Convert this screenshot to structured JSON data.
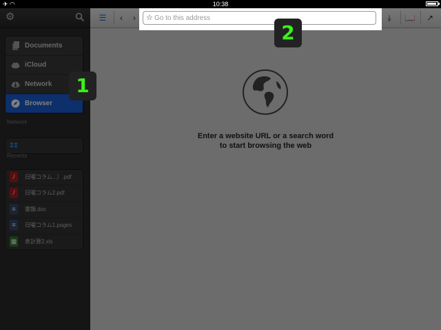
{
  "status_bar": {
    "time": "10:38"
  },
  "sidebar": {
    "nav_items": [
      {
        "label": "Documents",
        "icon": "documents-icon"
      },
      {
        "label": "iCloud",
        "icon": "cloud-icon"
      },
      {
        "label": "Network",
        "icon": "network-cloud-icon"
      },
      {
        "label": "Browser",
        "icon": "compass-icon",
        "active": true
      }
    ],
    "network_section_label": "Network",
    "recents_section_label": "Recents",
    "recents": [
      {
        "name": "日曜コラム...）.pdf",
        "type": "pdf"
      },
      {
        "name": "日曜コラム2.pdf",
        "type": "pdf"
      },
      {
        "name": "書類.doc",
        "type": "doc"
      },
      {
        "name": "日曜コラム1.pages",
        "type": "pages"
      },
      {
        "name": "表計算2.xls",
        "type": "xls"
      }
    ]
  },
  "browser": {
    "address_placeholder": "Go to this address",
    "empty_message_line1": "Enter a website URL or a search word",
    "empty_message_line2": "to start browsing the web"
  },
  "callouts": {
    "one": "1",
    "two": "2"
  },
  "colors": {
    "active_blue": "#1b5fd6",
    "badge_green": "#3cf01b"
  }
}
